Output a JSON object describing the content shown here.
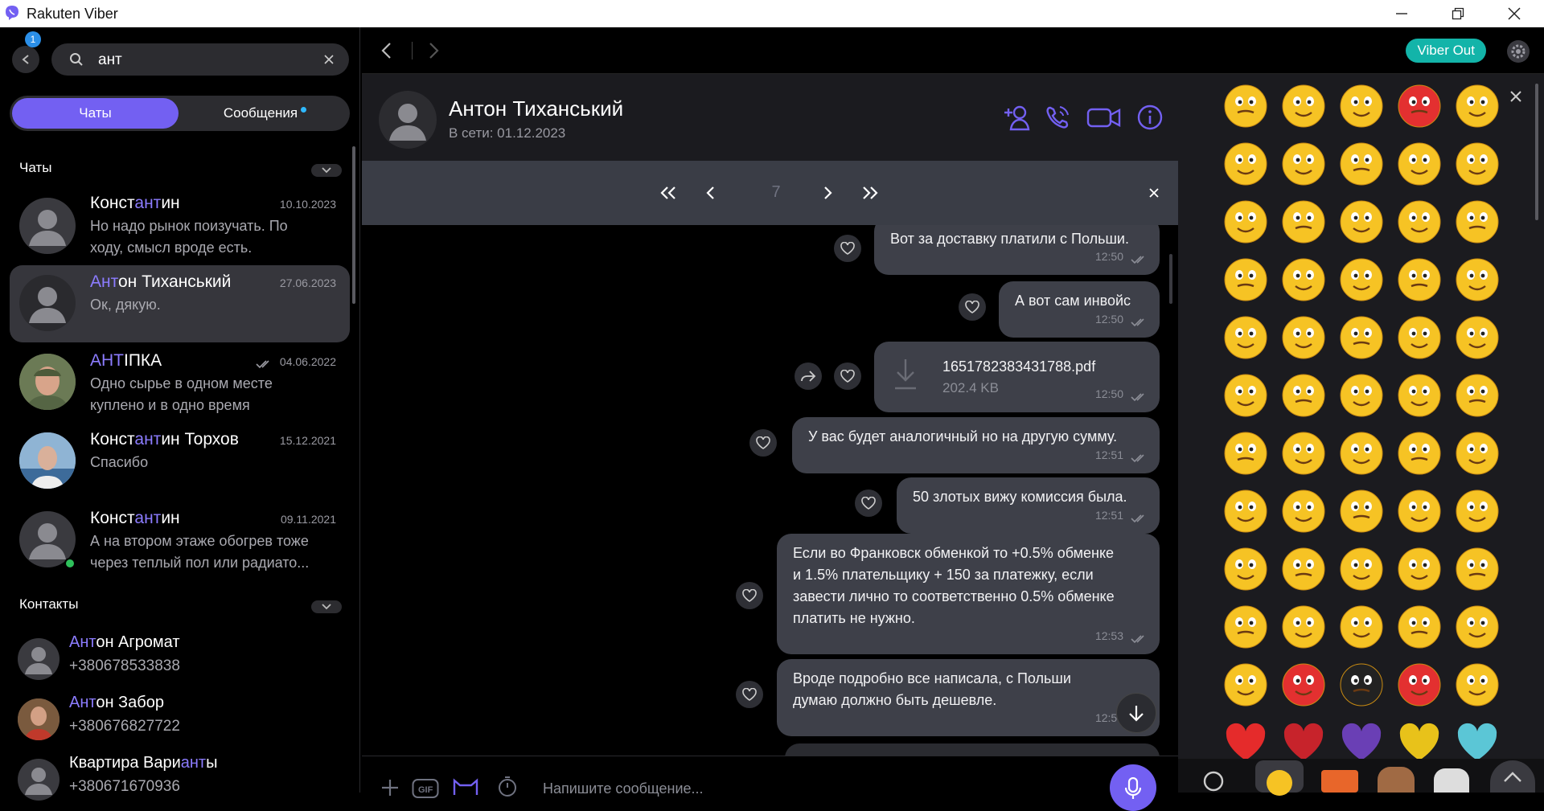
{
  "app": {
    "title": "Rakuten Viber",
    "notification_count": "1"
  },
  "search": {
    "value": "ант"
  },
  "segments": {
    "chats": "Чаты",
    "messages": "Сообщения"
  },
  "sections": {
    "chats": "Чаты",
    "contacts": "Контакты"
  },
  "chats": [
    {
      "name_pre": "Конст",
      "name_hl": "ант",
      "name_post": "ин",
      "date": "10.10.2023",
      "preview": "Но надо рынок поизучать. По ходу, смысл вроде есть."
    },
    {
      "name_pre": "",
      "name_hl": "Ант",
      "name_post": "он Тиханський",
      "date": "27.06.2023",
      "preview": "Ок, дякую."
    },
    {
      "name_pre": "",
      "name_hl": "АНТ",
      "name_post": "ІПКА",
      "date": "04.06.2022",
      "preview": "Одно сырье в одном месте куплено и в одно время"
    },
    {
      "name_pre": "Конст",
      "name_hl": "ант",
      "name_post": "ин Торхов",
      "date": "15.12.2021",
      "preview": "Спасибо"
    },
    {
      "name_pre": "Конст",
      "name_hl": "ант",
      "name_post": "ин",
      "date": "09.11.2021",
      "preview": "А на втором этаже обогрев тоже через теплый пол или радиато..."
    }
  ],
  "contacts": [
    {
      "name_pre": "",
      "name_hl": "Ант",
      "name_post": "он Агромат",
      "phone": "+380678533838"
    },
    {
      "name_pre": "",
      "name_hl": "Ант",
      "name_post": "он Забор",
      "phone": "+380676827722"
    },
    {
      "name_pre": "Квартира Вари",
      "name_hl": "ант",
      "name_post": "ы",
      "phone": "+380671670936"
    }
  ],
  "topbar": {
    "viber_out": "Viber Out"
  },
  "conversation": {
    "name": "Антон Тиханський",
    "status": "В сети: 01.12.2023"
  },
  "search_nav": {
    "current": "7"
  },
  "messages": [
    {
      "text": "Вот за доставку платили с Польши.",
      "time": "12:50"
    },
    {
      "text": "А вот сам инвойс",
      "time": "12:50"
    },
    {
      "file_name": "1651782383431788.pdf",
      "file_size": "202.4 KB",
      "time": "12:50"
    },
    {
      "text": "У вас будет аналогичный но на другую сумму.",
      "time": "12:51"
    },
    {
      "text": "50 злотых вижу комиссия была.",
      "time": "12:51"
    },
    {
      "lines": [
        "Если во Франковск обменкой то +0.5% обменке",
        "и 1.5% плательщику + 150 за платежку, если",
        "завести лично то соответственно 0.5% обменке",
        "платить не нужно."
      ],
      "time": "12:53"
    },
    {
      "lines": [
        "Вроде подробно все написала, с Польши",
        "думаю должно быть дешевле."
      ],
      "time": "12:54"
    }
  ],
  "composer": {
    "placeholder": "Напишите сообщение..."
  },
  "emoji_panel": {
    "rows": 12,
    "cols": 5
  }
}
